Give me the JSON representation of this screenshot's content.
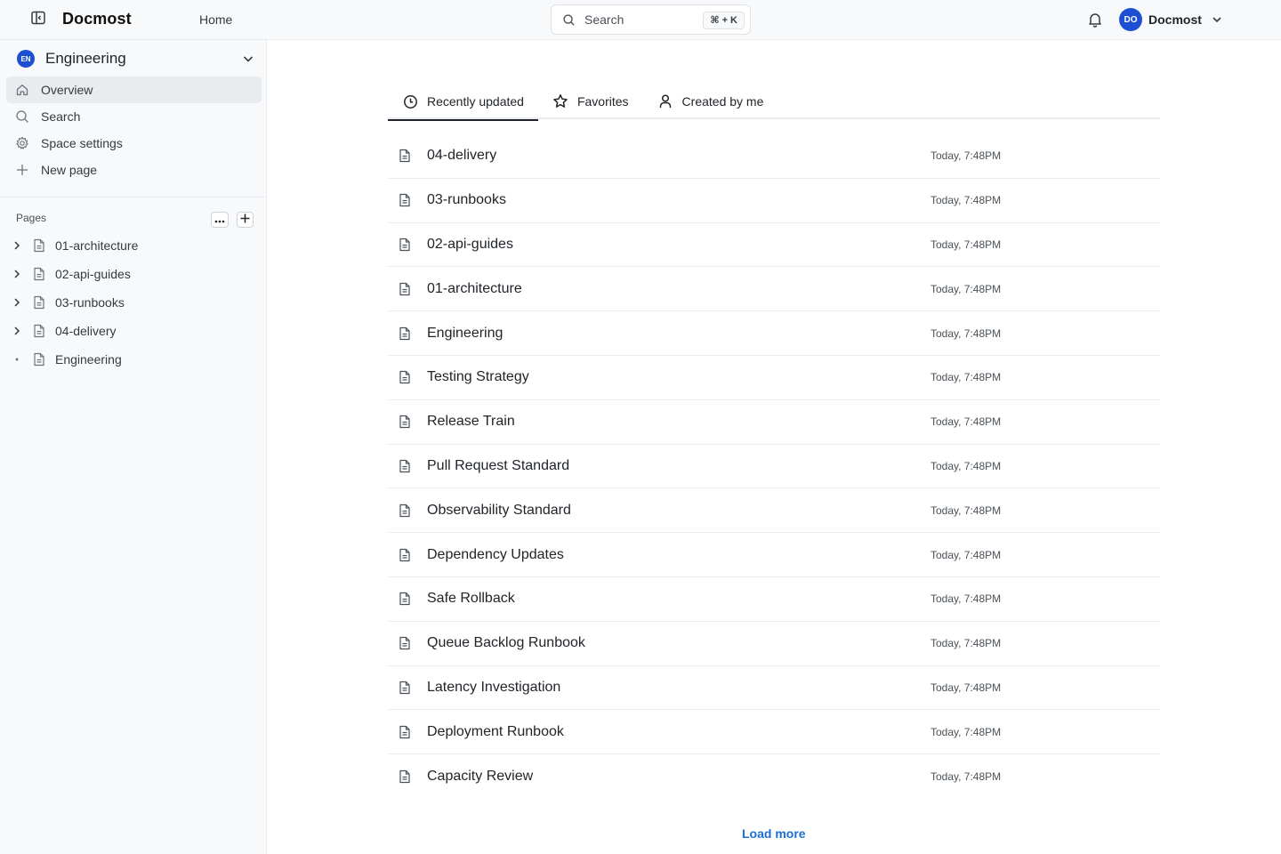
{
  "header": {
    "app_title": "Docmost",
    "home_label": "Home",
    "search_label": "Search",
    "search_shortcut": "⌘ + K",
    "user_initials": "DO",
    "user_name": "Docmost"
  },
  "sidebar": {
    "space_initials": "EN",
    "space_name": "Engineering",
    "nav": [
      {
        "label": "Overview",
        "icon": "home-icon"
      },
      {
        "label": "Search",
        "icon": "search-icon"
      },
      {
        "label": "Space settings",
        "icon": "gear-icon"
      },
      {
        "label": "New page",
        "icon": "plus-icon"
      }
    ],
    "pages_heading": "Pages",
    "tree": [
      {
        "label": "01-architecture"
      },
      {
        "label": "02-api-guides"
      },
      {
        "label": "03-runbooks"
      },
      {
        "label": "04-delivery"
      },
      {
        "label": "Engineering"
      }
    ]
  },
  "main": {
    "tabs": [
      {
        "label": "Recently updated",
        "icon": "clock-icon"
      },
      {
        "label": "Favorites",
        "icon": "star-icon"
      },
      {
        "label": "Created by me",
        "icon": "user-icon"
      }
    ],
    "pages": [
      {
        "title": "04-delivery",
        "updated": "Today, 7:48PM"
      },
      {
        "title": "03-runbooks",
        "updated": "Today, 7:48PM"
      },
      {
        "title": "02-api-guides",
        "updated": "Today, 7:48PM"
      },
      {
        "title": "01-architecture",
        "updated": "Today, 7:48PM"
      },
      {
        "title": "Engineering",
        "updated": "Today, 7:48PM"
      },
      {
        "title": "Testing Strategy",
        "updated": "Today, 7:48PM"
      },
      {
        "title": "Release Train",
        "updated": "Today, 7:48PM"
      },
      {
        "title": "Pull Request Standard",
        "updated": "Today, 7:48PM"
      },
      {
        "title": "Observability Standard",
        "updated": "Today, 7:48PM"
      },
      {
        "title": "Dependency Updates",
        "updated": "Today, 7:48PM"
      },
      {
        "title": "Safe Rollback",
        "updated": "Today, 7:48PM"
      },
      {
        "title": "Queue Backlog Runbook",
        "updated": "Today, 7:48PM"
      },
      {
        "title": "Latency Investigation",
        "updated": "Today, 7:48PM"
      },
      {
        "title": "Deployment Runbook",
        "updated": "Today, 7:48PM"
      },
      {
        "title": "Capacity Review",
        "updated": "Today, 7:48PM"
      }
    ],
    "load_more_label": "Load more"
  },
  "colors": {
    "accent": "#1c4fd1",
    "link": "#1c6fd1"
  }
}
